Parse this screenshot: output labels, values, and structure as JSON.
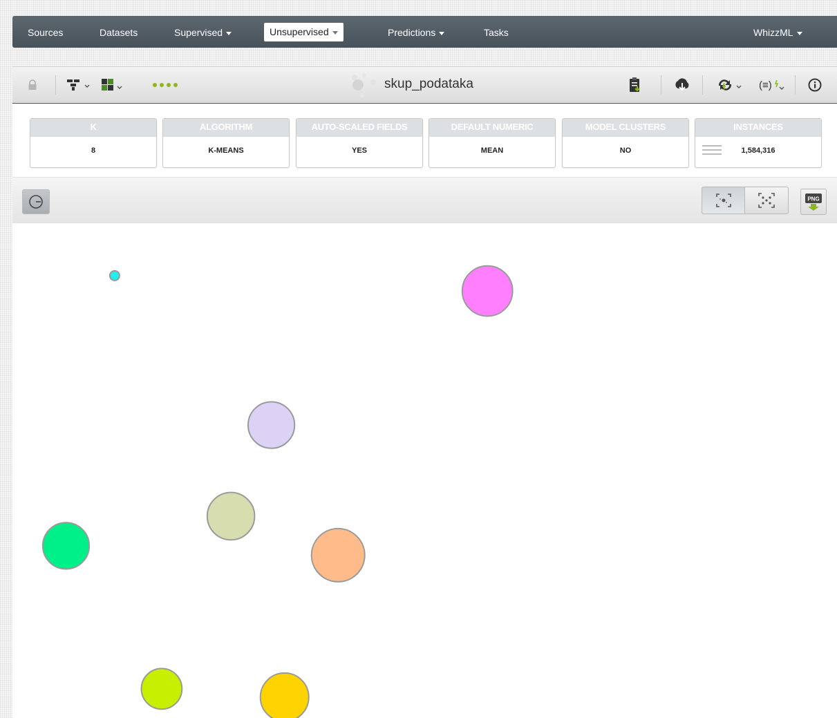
{
  "nav": {
    "items": [
      {
        "label": "Sources",
        "dropdown": false,
        "active": false
      },
      {
        "label": "Datasets",
        "dropdown": false,
        "active": false
      },
      {
        "label": "Supervised",
        "dropdown": true,
        "active": false
      },
      {
        "label": "Unsupervised",
        "dropdown": true,
        "active": true
      },
      {
        "label": "Predictions",
        "dropdown": true,
        "active": false
      },
      {
        "label": "Tasks",
        "dropdown": false,
        "active": false
      }
    ],
    "right": {
      "label": "WhizzML",
      "dropdown": true
    }
  },
  "toolbar": {
    "title": "skup_podataka",
    "accent": "#8cb81a",
    "icons": [
      "lock-icon",
      "tree-model-icon",
      "cluster-model-icon",
      "progress-dots-icon",
      "report-icon",
      "download-icon",
      "sync-icon",
      "formula-icon",
      "info-icon"
    ]
  },
  "summary": {
    "cards": [
      {
        "label": "K",
        "value": "8"
      },
      {
        "label": "ALGORITHM",
        "value": "K-MEANS"
      },
      {
        "label": "AUTO-SCALED FIELDS",
        "value": "YES"
      },
      {
        "label": "DEFAULT NUMERIC",
        "value": "MEAN"
      },
      {
        "label": "MODEL CLUSTERS",
        "value": "NO"
      },
      {
        "label": "INSTANCES",
        "value": "1,584,316"
      }
    ]
  },
  "chart_controls": {
    "left": [
      "reset-zoom-icon"
    ],
    "right": [
      "center-view-icon",
      "spread-view-icon",
      "png-export-icon"
    ],
    "png_label": "PNG"
  },
  "chart_data": {
    "type": "scatter",
    "title": "",
    "xlabel": "",
    "ylabel": "",
    "grid": false,
    "legend": "none",
    "points": [
      {
        "id": "cyan",
        "x": 0.124,
        "y": 0.106,
        "size": 1,
        "color": "#22eeee"
      },
      {
        "id": "magenta",
        "x": 0.576,
        "y": 0.137,
        "size": 5.2,
        "color": "#ff7fff"
      },
      {
        "id": "lavender",
        "x": 0.314,
        "y": 0.408,
        "size": 4.8,
        "color": "#dcd2f5"
      },
      {
        "id": "sage",
        "x": 0.265,
        "y": 0.592,
        "size": 4.9,
        "color": "#d8ddb0"
      },
      {
        "id": "green",
        "x": 0.065,
        "y": 0.652,
        "size": 4.8,
        "color": "#00f089"
      },
      {
        "id": "peach",
        "x": 0.395,
        "y": 0.671,
        "size": 5.5,
        "color": "#ffbb8a"
      },
      {
        "id": "lime",
        "x": 0.181,
        "y": 0.941,
        "size": 4.2,
        "color": "#c6f000"
      },
      {
        "id": "gold",
        "x": 0.33,
        "y": 0.958,
        "size": 5.0,
        "color": "#ffd300"
      }
    ]
  }
}
